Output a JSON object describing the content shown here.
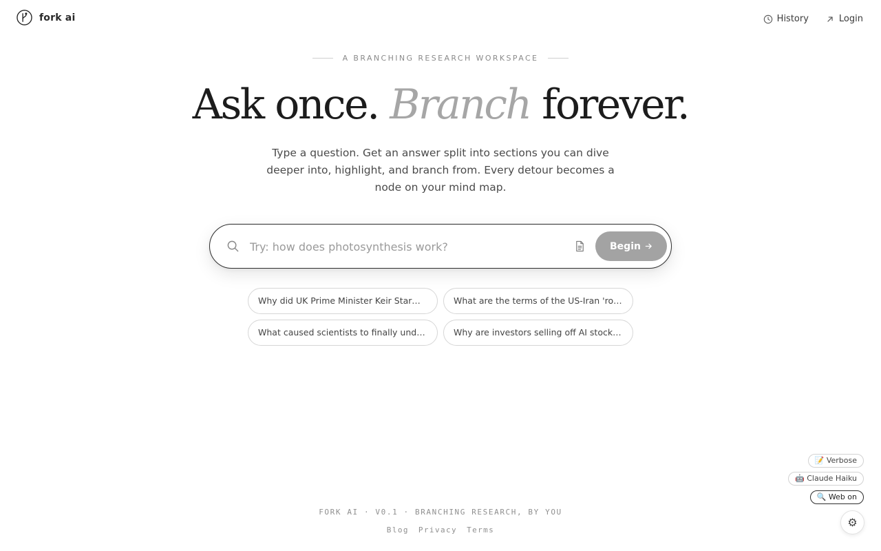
{
  "header": {
    "brand_name": "fork ai",
    "nav": [
      {
        "label": "History",
        "icon": "clock-icon"
      },
      {
        "label": "Login",
        "icon": "arrow-up-right-icon"
      }
    ]
  },
  "hero": {
    "eyebrow": "A BRANCHING RESEARCH WORKSPACE",
    "headline_part1": "Ask once.",
    "headline_accent": "Branch",
    "headline_part2": "forever.",
    "subtitle": "Type a question. Get an answer split into sections you can dive deeper into, highlight, and branch from. Every detour becomes a node on your mind map."
  },
  "search": {
    "placeholder": "Try: how does photosynthesis work?",
    "value": "",
    "begin_label": "Begin"
  },
  "suggestions": [
    "Why did UK Prime Minister Keir Starmer …",
    "What are the terms of the US-Iran 'road…",
    "What caused scientists to finally unders…",
    "Why are investors selling off AI stocks i…"
  ],
  "settings": {
    "verbose": "📝 Verbose",
    "model": "🤖 Claude Haiku",
    "web": "🔍 Web on",
    "gear": "⚙"
  },
  "footer": {
    "tagline": "FORK AI · V0.1 · BRANCHING RESEARCH, BY YOU",
    "links": [
      "Blog",
      "Privacy",
      "Terms"
    ]
  },
  "colors": {
    "accent_gray": "#a6a6a6",
    "button_gray": "#a3a3a3",
    "text_dark": "#1c1c1c"
  }
}
